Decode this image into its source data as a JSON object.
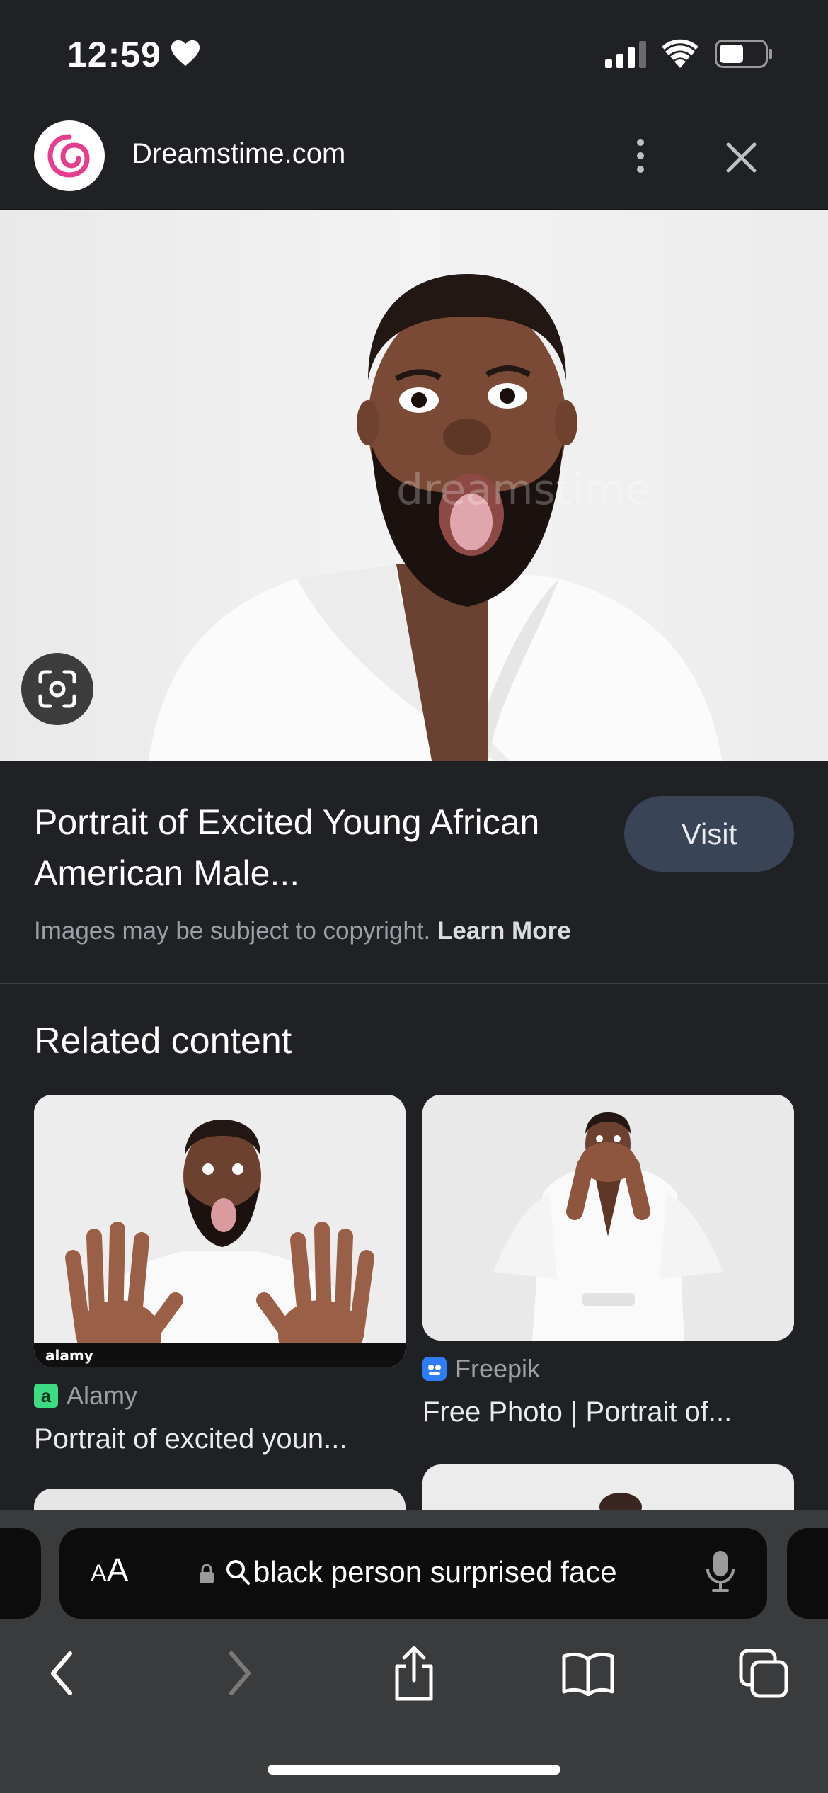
{
  "status_bar": {
    "time": "12:59"
  },
  "header": {
    "site_name": "Dreamstime.com"
  },
  "hero": {
    "watermark": "dreamstime"
  },
  "result": {
    "title": "Portrait of Excited Young African American Male...",
    "visit_label": "Visit",
    "copyright_text": "Images may be subject to copyright.",
    "learn_more": "Learn More"
  },
  "related": {
    "heading": "Related content",
    "items": [
      {
        "source": "Alamy",
        "title": "Portrait of excited youn...",
        "watermark": "alamy",
        "source_color": "#3ddc84"
      },
      {
        "source": "Freepik",
        "title": "Free Photo | Portrait of...",
        "source_color": "#2e7cf6"
      }
    ]
  },
  "address_bar": {
    "aa_label": "AA",
    "query": "black person surprised face"
  }
}
